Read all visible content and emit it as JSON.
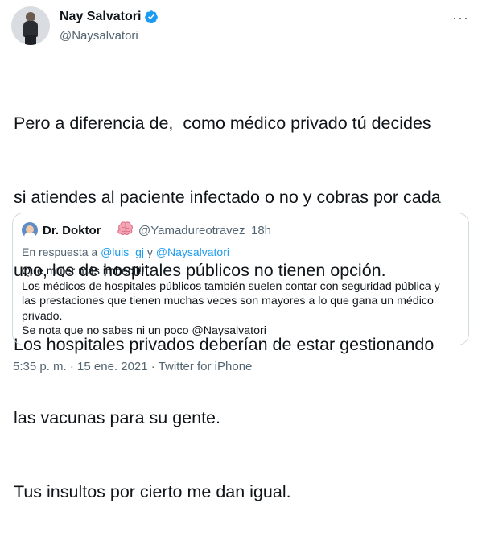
{
  "author": {
    "name": "Nay Salvatori",
    "handle": "@Naysalvatori",
    "verified_icon": "verified-badge-icon",
    "more_icon": "more-options-icon"
  },
  "tweet": {
    "lines": [
      "Pero a diferencia de,  como médico privado tú decides",
      "si atiendes al paciente infectado o no y cobras por cada",
      "uno, los de hospitales públicos no tienen opción.",
      "Los hospitales privados deberían de estar gestionando",
      "las vacunas para su gente.",
      "Tus insultos por cierto me dan igual."
    ]
  },
  "quoted": {
    "name": "Dr. Doktor",
    "name_emoji_icon": "brain-emoji-icon",
    "handle": "@Yamadureotravez",
    "separator": "·",
    "time": "18h",
    "reply_prefix": "En respuesta a",
    "reply_user1": "@luis_gj",
    "reply_joiner": "y",
    "reply_user2": "@Naysalvatori",
    "lines": [
      "Que mujer más imbecil!!",
      "Los médicos de hospitales públicos también suelen contar con seguridad pública y",
      "las prestaciones que tienen muchas veces son mayores a lo que gana un médico",
      "privado.",
      "Se nota que no sabes ni un poco @Naysalvatori"
    ]
  },
  "footer": {
    "meta": "5:35 p. m. · 15 ene. 2021 · Twitter for iPhone"
  },
  "colors": {
    "link": "#1d9bf0",
    "secondary_text": "#536471",
    "border": "#cfd9de"
  }
}
